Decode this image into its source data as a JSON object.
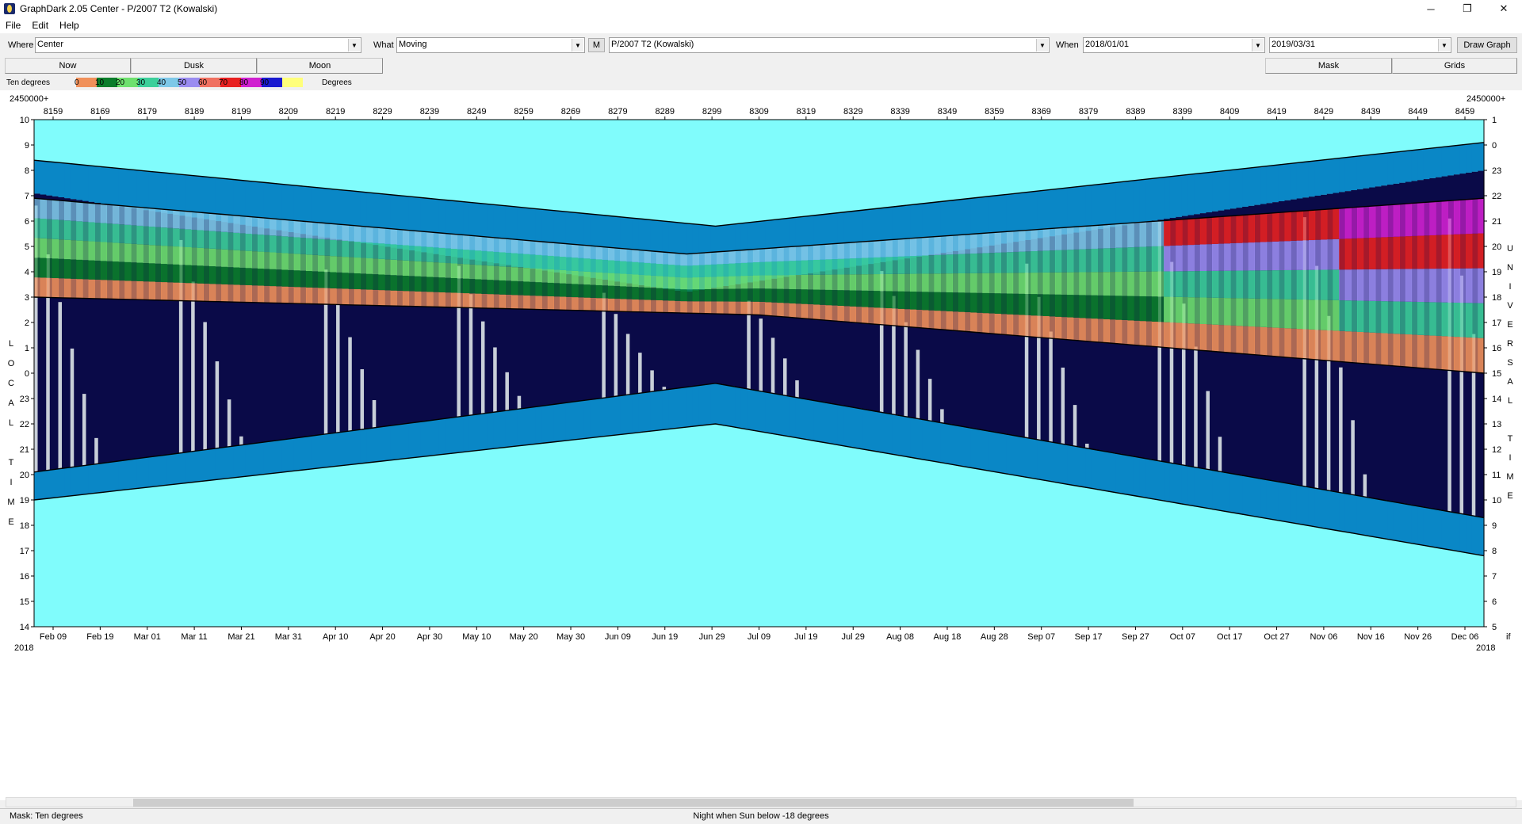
{
  "window": {
    "title": "GraphDark 2.05  Center  -  P/2007 T2 (Kowalski)",
    "minimize": "─",
    "restore": "❐",
    "close": "✕"
  },
  "menu": [
    "File",
    "Edit",
    "Help"
  ],
  "toolbar": {
    "where_label": "Where",
    "where_value": "Center",
    "what_label": "What",
    "what_value": "Moving",
    "m_button": "M",
    "object_value": "P/2007 T2 (Kowalski)",
    "when_label": "When",
    "when_start": "2018/01/01",
    "when_end": "2019/03/31",
    "draw_button": "Draw Graph"
  },
  "tabs": {
    "now": "Now",
    "dusk": "Dusk",
    "moon": "Moon",
    "mask": "Mask",
    "grids": "Grids"
  },
  "legend": {
    "left_label": "Ten degrees",
    "right_label": "Degrees",
    "scale": [
      "0",
      "10",
      "20",
      "30",
      "40",
      "50",
      "60",
      "70",
      "80",
      "90"
    ],
    "colors": [
      "#f0905a",
      "#0a7d2a",
      "#6ee06e",
      "#3ccf9a",
      "#7ec8e8",
      "#9a8cf0",
      "#f07060",
      "#e82020",
      "#d020d0",
      "#1a1ad0",
      "#ffff7a"
    ]
  },
  "plot": {
    "jd_prefix": "2450000+",
    "jd_ticks": [
      "8159",
      "8169",
      "8179",
      "8189",
      "8199",
      "8209",
      "8219",
      "8229",
      "8239",
      "8249",
      "8259",
      "8269",
      "8279",
      "8289",
      "8299",
      "8309",
      "8319",
      "8329",
      "8339",
      "8349",
      "8359",
      "8369",
      "8379",
      "8389",
      "8399",
      "8409",
      "8419",
      "8429",
      "8439",
      "8449",
      "8459"
    ],
    "date_ticks": [
      "Feb 09",
      "Feb 19",
      "Mar 01",
      "Mar 11",
      "Mar 21",
      "Mar 31",
      "Apr 10",
      "Apr 20",
      "Apr 30",
      "May 10",
      "May 20",
      "May 30",
      "Jun 09",
      "Jun 19",
      "Jun 29",
      "Jul 09",
      "Jul 19",
      "Jul 29",
      "Aug 08",
      "Aug 18",
      "Aug 28",
      "Sep 07",
      "Sep 17",
      "Sep 27",
      "Oct 07",
      "Oct 17",
      "Oct 27",
      "Nov 06",
      "Nov 16",
      "Nov 26",
      "Dec 06"
    ],
    "year_left": "2018",
    "year_right": "2018",
    "right_tail": "if",
    "left_axis_title": [
      "L",
      "O",
      "C",
      "A",
      "L",
      "",
      "T",
      "I",
      "M",
      "E"
    ],
    "right_axis_title": [
      "U",
      "N",
      "I",
      "V",
      "E",
      "R",
      "S",
      "A",
      "L",
      "",
      "T",
      "I",
      "M",
      "E"
    ],
    "left_ticks": [
      "10",
      "9",
      "8",
      "7",
      "6",
      "5",
      "4",
      "3",
      "2",
      "1",
      "0",
      "23",
      "22",
      "21",
      "20",
      "19",
      "18",
      "17",
      "16",
      "15",
      "14"
    ],
    "right_ticks": [
      "1",
      "0",
      "23",
      "22",
      "21",
      "20",
      "19",
      "18",
      "17",
      "16",
      "15",
      "14",
      "13",
      "12",
      "11",
      "10",
      "9",
      "8",
      "7",
      "6",
      "5"
    ],
    "sky_color": "#80fcfc",
    "night_color": "#0a0a48",
    "moon_color": "#c8cfd8",
    "twilight_color": "#0a87c6"
  },
  "status": {
    "mask": "Mask:  Ten degrees",
    "night": "Night when Sun below -18 degrees"
  }
}
